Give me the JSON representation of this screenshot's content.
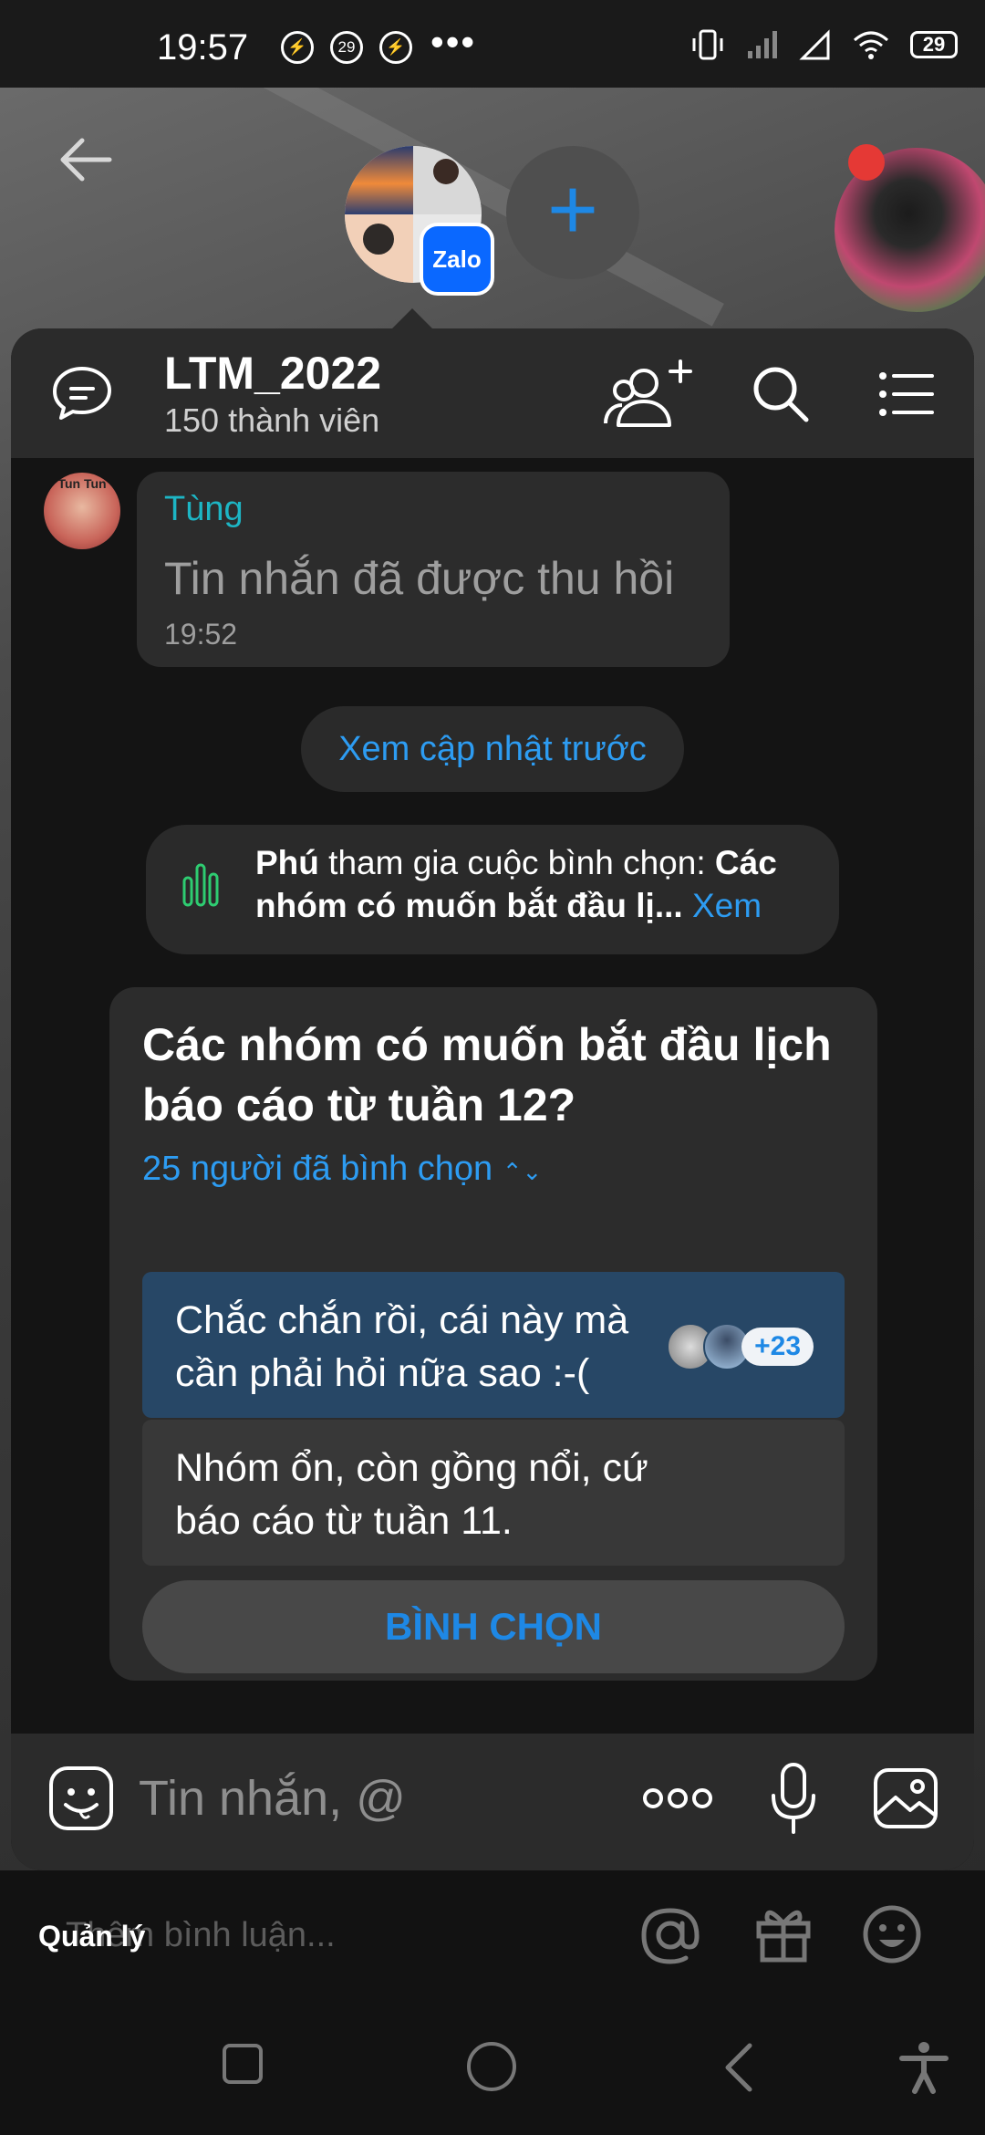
{
  "status_bar": {
    "time": "19:57",
    "notif_count": "29",
    "more": "•••",
    "battery": "29"
  },
  "header": {
    "title": "LTM_2022",
    "subtitle": "150 thành viên",
    "badge_app": "Zalo"
  },
  "message": {
    "avatar_label": "Tun Tun",
    "sender": "Tùng",
    "text": "Tin nhắn đã được thu hồi",
    "time": "19:52"
  },
  "see_previous_updates": "Xem cập nhật trước",
  "poll_notice": {
    "actor": "Phú",
    "action": " tham gia cuộc bình chọn: ",
    "poll_title_short": "Các nhóm có muốn bắt đầu lị...",
    "link": "Xem"
  },
  "poll": {
    "question": "Các nhóm có muốn bắt đầu lịch báo cáo từ tuần 12?",
    "votes_summary": "25 người đã bình chọn",
    "options": [
      {
        "text": "Chắc chắn rồi, cái này mà cần phải hỏi nữa sao :-(",
        "extra_voters": "+23",
        "selected": true
      },
      {
        "text": "Nhóm ổn, còn gồng nổi, cứ báo cáo từ tuần 11.",
        "selected": false
      }
    ],
    "vote_button": "BÌNH CHỌN"
  },
  "composer": {
    "placeholder": "Tin nhắn, @"
  },
  "live_bar": {
    "manage": "Quản lý",
    "comment_placeholder": "Thêm bình luận..."
  },
  "colors": {
    "accent": "#1e88e5",
    "link": "#2d9cf2",
    "sender": "#1db5c4",
    "poll_icon": "#2ecc71",
    "selected_option": "#274766"
  }
}
